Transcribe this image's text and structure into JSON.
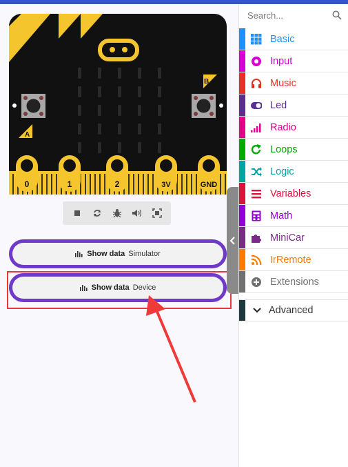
{
  "search": {
    "placeholder": "Search..."
  },
  "board": {
    "pins": [
      "0",
      "1",
      "2",
      "3V",
      "GND"
    ],
    "button_a": "A",
    "button_b": "B"
  },
  "show_data": [
    {
      "label": "Show data",
      "target": "Simulator"
    },
    {
      "label": "Show data",
      "target": "Device"
    }
  ],
  "categories": [
    {
      "label": "Basic",
      "color": "#1e90ff",
      "icon": "grid-icon"
    },
    {
      "label": "Input",
      "color": "#d400d4",
      "icon": "radio-dot-icon"
    },
    {
      "label": "Music",
      "color": "#e63022",
      "icon": "headphones-icon"
    },
    {
      "label": "Led",
      "color": "#5c2d91",
      "icon": "toggle-icon"
    },
    {
      "label": "Radio",
      "color": "#e3008c",
      "icon": "signal-bars-icon"
    },
    {
      "label": "Loops",
      "color": "#00aa00",
      "icon": "refresh-icon"
    },
    {
      "label": "Logic",
      "color": "#00a4a6",
      "icon": "shuffle-icon"
    },
    {
      "label": "Variables",
      "color": "#dc143c",
      "icon": "list-icon"
    },
    {
      "label": "Math",
      "color": "#9400d3",
      "icon": "calculator-icon"
    },
    {
      "label": "MiniCar",
      "color": "#7b2a8a",
      "icon": "puzzle-icon"
    },
    {
      "label": "IrRemote",
      "color": "#ff7a00",
      "icon": "wifi-icon"
    },
    {
      "label": "Extensions",
      "color": "#717171",
      "icon": "plus-circle-icon"
    }
  ],
  "advanced": {
    "label": "Advanced",
    "color": "#1c3a3e"
  }
}
